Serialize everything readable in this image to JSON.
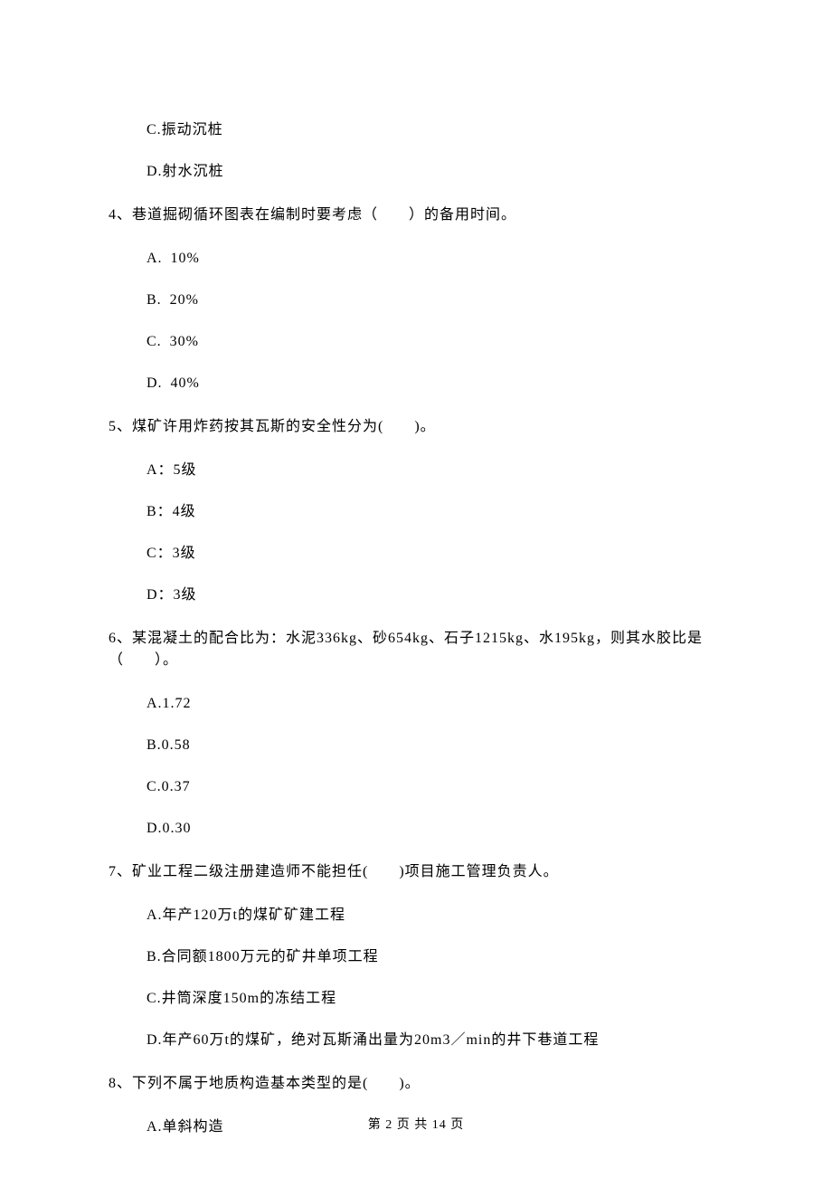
{
  "pre_options": {
    "c": "C.振动沉桩",
    "d": "D.射水沉桩"
  },
  "q4": {
    "stem": "4、巷道掘砌循环图表在编制时要考虑（　　）的备用时间。",
    "a": "A. 10%",
    "b": "B. 20%",
    "c": "C. 30%",
    "d": "D. 40%"
  },
  "q5": {
    "stem": "5、煤矿许用炸药按其瓦斯的安全性分为(　　)。",
    "a": "A：5级",
    "b": "B：4级",
    "c": "C：3级",
    "d": "D：3级"
  },
  "q6": {
    "stem": "6、某混凝土的配合比为：水泥336kg、砂654kg、石子1215kg、水195kg，则其水胶比是（　　）。",
    "a": "A.1.72",
    "b": "B.0.58",
    "c": "C.0.37",
    "d": "D.0.30"
  },
  "q7": {
    "stem": "7、矿业工程二级注册建造师不能担任(　　)项目施工管理负责人。",
    "a": "A.年产120万t的煤矿矿建工程",
    "b": "B.合同额1800万元的矿井单项工程",
    "c": "C.井筒深度150m的冻结工程",
    "d": "D.年产60万t的煤矿，绝对瓦斯涌出量为20m3／min的井下巷道工程"
  },
  "q8": {
    "stem": "8、下列不属于地质构造基本类型的是(　　)。",
    "a": "A.单斜构造"
  },
  "footer": "第 2 页 共 14 页"
}
